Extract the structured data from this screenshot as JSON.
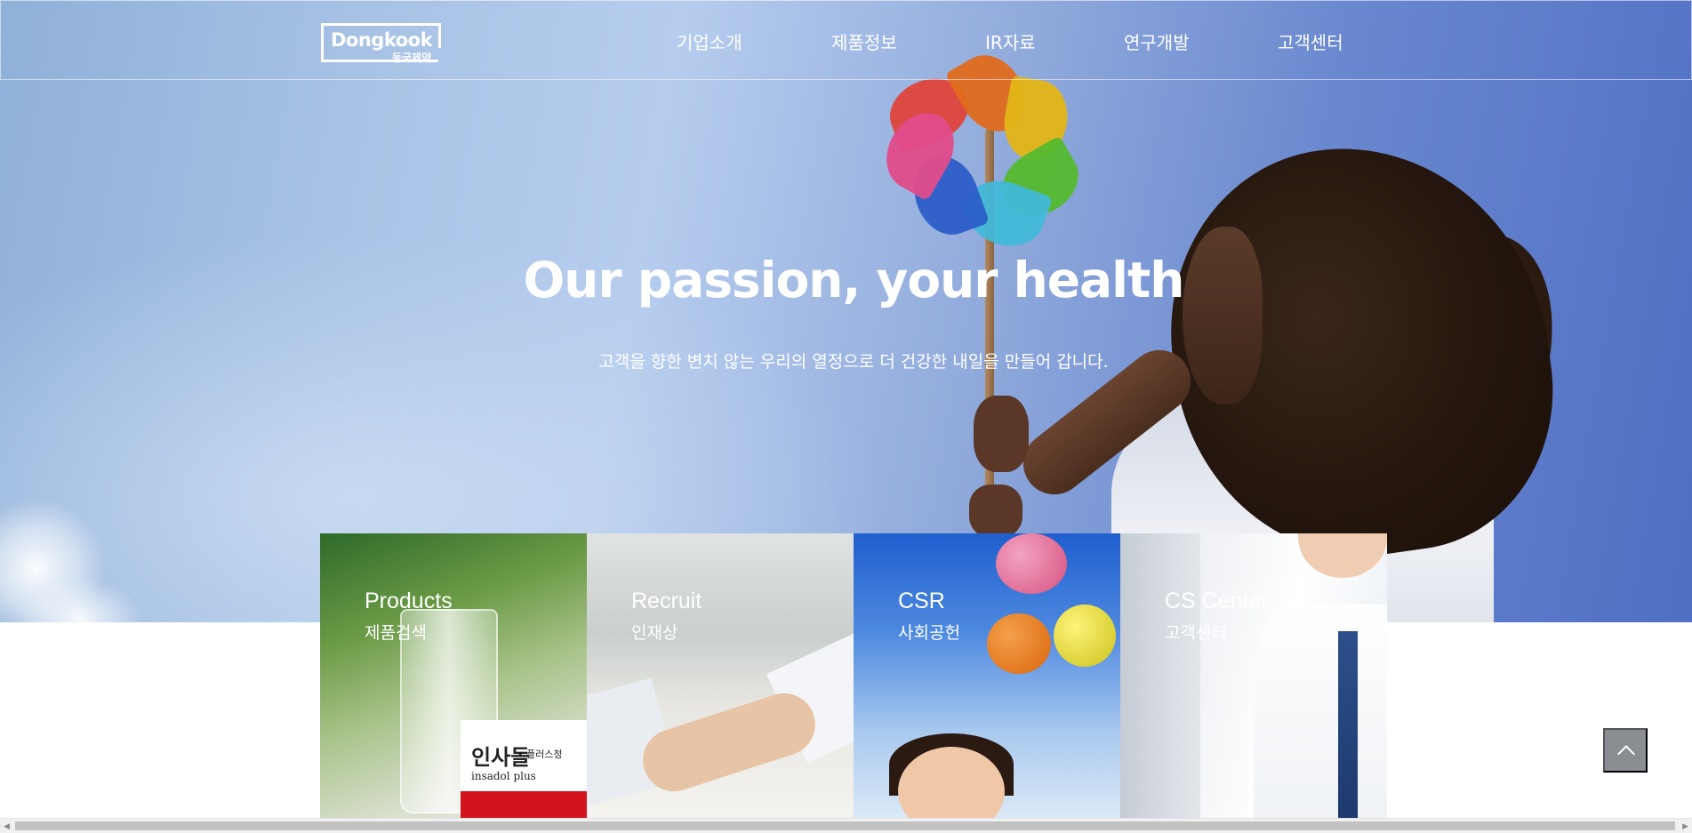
{
  "header": {
    "logo_en": "Dongkook",
    "logo_ko": "동국제약",
    "nav": [
      {
        "label": "기업소개"
      },
      {
        "label": "제품정보"
      },
      {
        "label": "IR자료"
      },
      {
        "label": "연구개발"
      },
      {
        "label": "고객센터"
      }
    ]
  },
  "hero": {
    "title": "Our passion, your health",
    "subtitle": "고객을 향한 변치 않는 우리의 열정으로 더 건강한 내일을 만들어 갑니다."
  },
  "cards": [
    {
      "title_en": "Products",
      "title_ko": "제품검색",
      "product_name": "인사돌",
      "product_sub": "플러스정",
      "product_en": "insadol plus"
    },
    {
      "title_en": "Recruit",
      "title_ko": "인재상"
    },
    {
      "title_en": "CSR",
      "title_ko": "사회공헌"
    },
    {
      "title_en": "CS Center",
      "title_ko": "고객센터"
    }
  ],
  "colors": {
    "sky_accent": "#6a88cf",
    "scroll_top_bg": "#8a8d92",
    "product_red": "#d3141e"
  },
  "icons": {
    "scroll_top": "chevron-up-icon",
    "scroll_left": "caret-left-icon",
    "scroll_right": "caret-right-icon"
  }
}
